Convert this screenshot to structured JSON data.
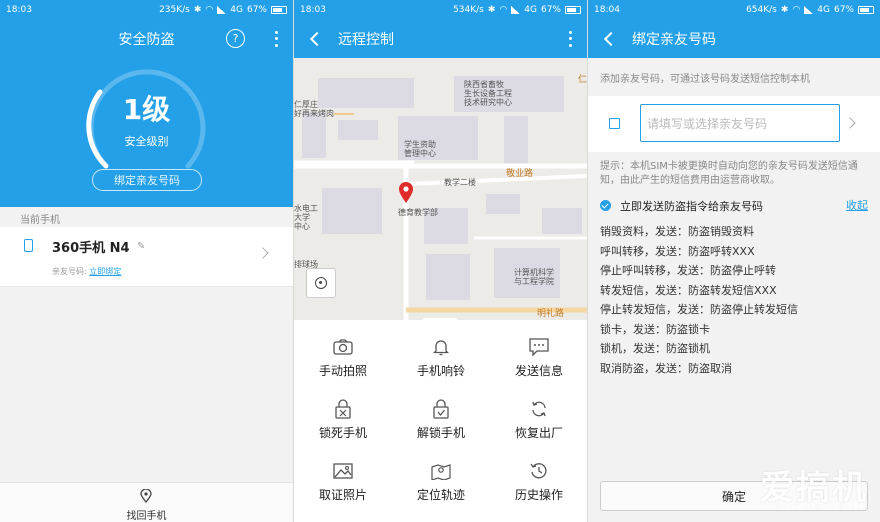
{
  "colors": {
    "accent": "#23a0e8",
    "link": "#23a0e8"
  },
  "panel1": {
    "status": {
      "time": "18:03",
      "speed": "235K/s",
      "network": "4G",
      "battery": "67%"
    },
    "title": "安全防盗",
    "help_glyph": "?",
    "level": "1级",
    "level_label": "安全级别",
    "bind_button": "绑定亲友号码",
    "section_label": "当前手机",
    "device_name": "360手机 N4",
    "friend_label": "亲友号码:",
    "bind_link": "立即绑定",
    "bottom_label": "找回手机"
  },
  "panel2": {
    "status": {
      "time": "18:03",
      "speed": "534K/s",
      "network": "4G",
      "battery": "67%"
    },
    "title": "远程控制",
    "map_labels": {
      "institute": "陕西省畜牧\n生长设备工程\n技术研究中心",
      "restaurant": "仁厚庄\n好再来烤肉",
      "funding": "学生资助\n管理中心",
      "building2": "教学二楼",
      "dept": "德育教学部",
      "hydro": "水电工\n大学\n中心",
      "field": "排球场",
      "cs": "计算机科学\n与工程学院",
      "road1": "敬业路",
      "road2": "明礼路",
      "edge": "仁"
    },
    "actions": [
      {
        "label": "手动拍照",
        "icon": "camera-icon"
      },
      {
        "label": "手机响铃",
        "icon": "bell-icon"
      },
      {
        "label": "发送信息",
        "icon": "message-icon"
      },
      {
        "label": "锁死手机",
        "icon": "lock-icon"
      },
      {
        "label": "解锁手机",
        "icon": "unlock-icon"
      },
      {
        "label": "恢复出厂",
        "icon": "refresh-icon"
      },
      {
        "label": "取证照片",
        "icon": "photo-icon"
      },
      {
        "label": "定位轨迹",
        "icon": "map-track-icon"
      },
      {
        "label": "历史操作",
        "icon": "history-icon"
      }
    ]
  },
  "panel3": {
    "status": {
      "time": "18:04",
      "speed": "654K/s",
      "network": "4G",
      "battery": "67%"
    },
    "title": "绑定亲友号码",
    "hint_top": "添加亲友号码，可通过该号码发送短信控制本机",
    "input_placeholder": "请填写或选择亲友号码",
    "tip": "提示：本机SIM卡被更换时自动向您的亲友号码发送短信通知，由此产生的短信费用由运营商收取。",
    "send_label": "立即发送防盗指令给亲友号码",
    "collapse": "收起",
    "commands": [
      "销毁资料，发送：防盗销毁资料",
      "呼叫转移，发送：防盗呼转XXX",
      "停止呼叫转移，发送：防盗停止呼转",
      "转发短信，发送：防盗转发短信XXX",
      "停止转发短信，发送：防盗停止转发短信",
      "锁卡，发送：防盗锁卡",
      "锁机，发送：防盗锁机",
      "取消防盗，发送：防盗取消"
    ],
    "confirm": "确定",
    "watermark": "爱搞机",
    "watermark_sub": "IGAO7.COM"
  }
}
